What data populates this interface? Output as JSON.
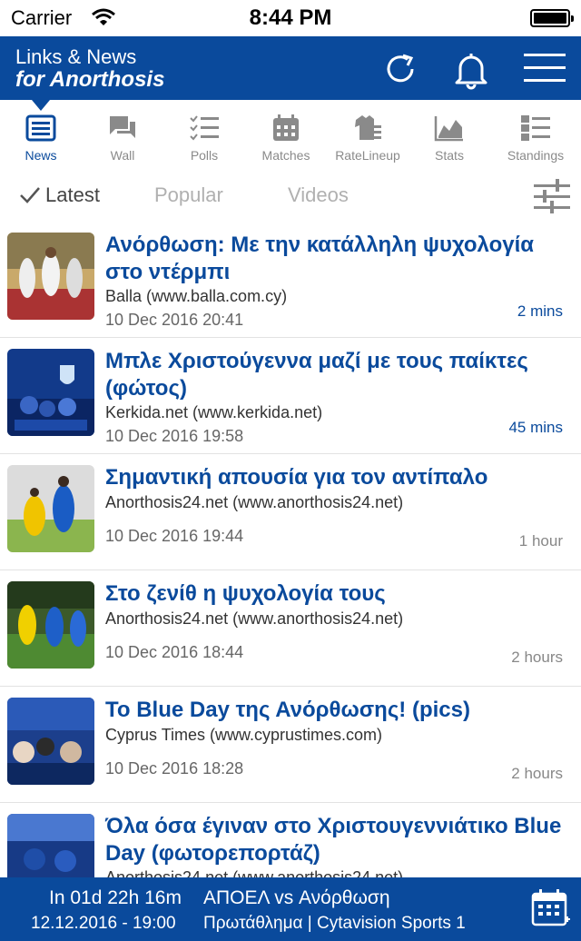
{
  "status_bar": {
    "carrier": "Carrier",
    "time": "8:44 PM"
  },
  "app_bar": {
    "title_line1": "Links & News",
    "title_line2": "for Anorthosis"
  },
  "tabs": [
    {
      "label": "News",
      "icon": "news-icon",
      "active": true
    },
    {
      "label": "Wall",
      "icon": "chat-icon"
    },
    {
      "label": "Polls",
      "icon": "checklist-icon"
    },
    {
      "label": "Matches",
      "icon": "calendar-icon"
    },
    {
      "label": "RateLineup",
      "icon": "jersey-icon"
    },
    {
      "label": "Stats",
      "icon": "chart-icon"
    },
    {
      "label": "Standings",
      "icon": "ranking-icon"
    }
  ],
  "filters": [
    {
      "label": "Latest",
      "active": true
    },
    {
      "label": "Popular"
    },
    {
      "label": "Videos"
    }
  ],
  "colors": {
    "brand": "#0a4a9c",
    "recent_time": "#0a4a9c",
    "old_time": "#888888"
  },
  "news": [
    {
      "title": "Ανόρθωση: Με την κατάλληλη ψυχολογία στο ντέρμπι",
      "source": "Balla (www.balla.com.cy)",
      "date": "10 Dec 2016 20:41",
      "ago": "2 mins"
    },
    {
      "title": "Μπλε Χριστούγεννα μαζί με τους παίκτες (φώτος)",
      "source": "Kerkida.net (www.kerkida.net)",
      "date": "10 Dec 2016 19:58",
      "ago": "45 mins"
    },
    {
      "title": "Σημαντική απουσία για τον αντίπαλο",
      "source": "Anorthosis24.net (www.anorthosis24.net)",
      "date": "10 Dec 2016 19:44",
      "ago": "1 hour"
    },
    {
      "title": "Στο ζενίθ η ψυχολογία τους",
      "source": "Anorthosis24.net (www.anorthosis24.net)",
      "date": "10 Dec 2016 18:44",
      "ago": "2 hours"
    },
    {
      "title": "Το Blue Day της Ανόρθωσης! (pics)",
      "source": "Cyprus Times (www.cyprustimes.com)",
      "date": "10 Dec 2016 18:28",
      "ago": "2 hours"
    },
    {
      "title": "Όλα όσα έγιναν στο Χριστουγεννιάτικο Blue Day (φωτορεπορτάζ)",
      "source": "Anorthosis24.net (www.anorthosis24.net)",
      "date": "",
      "ago": ""
    }
  ],
  "footer": {
    "countdown": "In 01d 22h 16m",
    "match": "ΑΠΟΕΛ vs Ανόρθωση",
    "datetime": "12.12.2016 - 19:00",
    "details": "Πρωτάθλημα | Cytavision Sports 1"
  }
}
